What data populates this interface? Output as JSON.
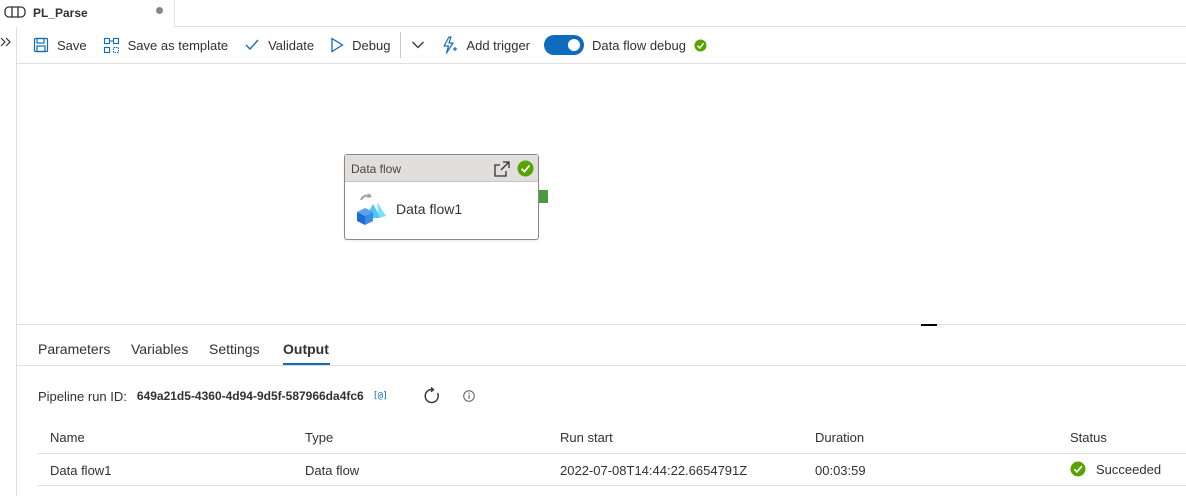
{
  "tab": {
    "title": "PL_Parse"
  },
  "toolbar": {
    "save": "Save",
    "save_template": "Save as template",
    "validate": "Validate",
    "debug": "Debug",
    "add_trigger": "Add trigger",
    "data_flow_debug": "Data flow debug"
  },
  "activity": {
    "type": "Data flow",
    "name": "Data flow1"
  },
  "bottom_panel": {
    "tabs": [
      "Parameters",
      "Variables",
      "Settings",
      "Output"
    ],
    "active_tab": "Output",
    "run_id_label": "Pipeline run ID:",
    "run_id_value": "649a21d5-4360-4d94-9d5f-587966da4fc6",
    "copy_glyph": "[@]",
    "columns": [
      "Name",
      "Type",
      "Run start",
      "Duration",
      "Status"
    ],
    "rows": [
      {
        "name": "Data flow1",
        "type": "Data flow",
        "run_start": "2022-07-08T14:44:22.6654791Z",
        "duration": "00:03:59",
        "status": "Succeeded"
      }
    ]
  },
  "colors": {
    "accent": "#0f6cbd",
    "success": "#57a300",
    "port": "#4c9a40"
  }
}
